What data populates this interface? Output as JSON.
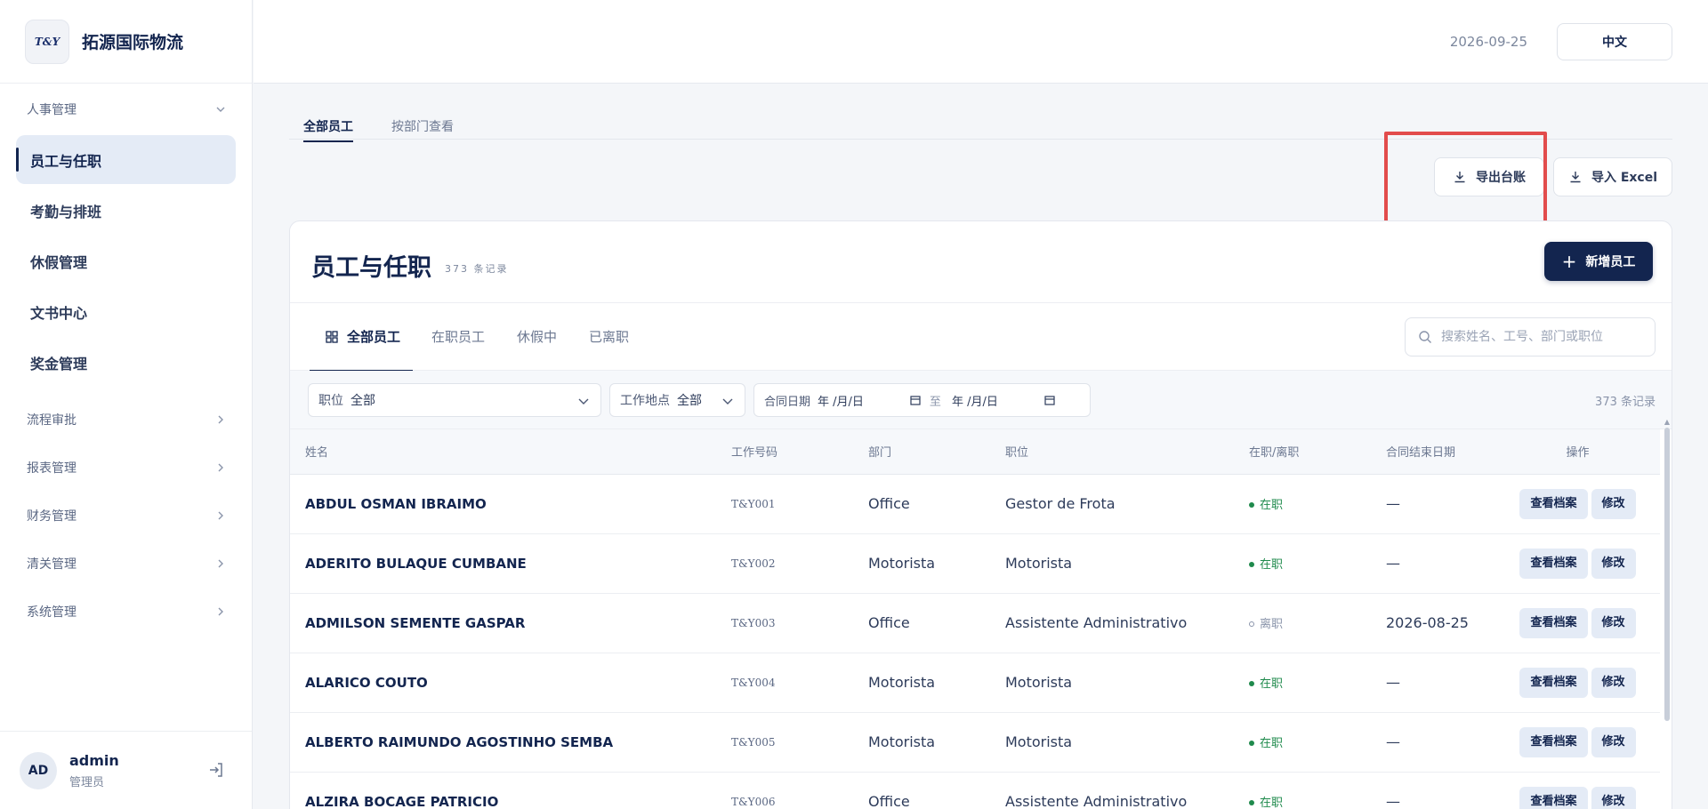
{
  "brand": {
    "logo_text": "T&Y",
    "name": "拓源国际物流"
  },
  "sidebar": {
    "groups": [
      {
        "label": "人事管理",
        "open": true
      },
      {
        "label": "流程审批"
      },
      {
        "label": "报表管理"
      },
      {
        "label": "财务管理"
      },
      {
        "label": "清关管理"
      },
      {
        "label": "系统管理"
      }
    ],
    "items": [
      {
        "label": "员工与任职",
        "active": true
      },
      {
        "label": "考勤与排班"
      },
      {
        "label": "休假管理"
      },
      {
        "label": "文书中心"
      },
      {
        "label": "奖金管理"
      }
    ]
  },
  "user": {
    "initials": "AD",
    "name": "admin",
    "role": "管理员"
  },
  "topbar": {
    "date": "2026-09-25",
    "language": "中文"
  },
  "page_tabs": [
    {
      "label": "全部员工",
      "active": true
    },
    {
      "label": "按部门查看"
    }
  ],
  "actions": {
    "export_label": "导出台账",
    "import_label": "导入 Excel"
  },
  "card": {
    "title": "员工与任职",
    "count": "373 条记录",
    "add_label": "新增员工",
    "status_tabs": [
      "全部员工",
      "在职员工",
      "休假中",
      "已离职"
    ],
    "search_placeholder": "搜索姓名、工号、部门或职位",
    "filters": {
      "position_label": "职位",
      "position_value": "全部",
      "location_label": "工作地点",
      "location_value": "全部",
      "date_label": "合同日期",
      "date_from": "年 /月/日",
      "date_sep": "至",
      "date_to": "年 /月/日"
    },
    "records_right": "373 条记录"
  },
  "table": {
    "columns": [
      "姓名",
      "工作号码",
      "部门",
      "职位",
      "在职/离职",
      "合同结束日期",
      "操作"
    ],
    "view_label": "查看档案",
    "edit_label": "修改",
    "rows": [
      {
        "name": "ABDUL OSMAN IBRAIMO",
        "code": "T&Y001",
        "dept": "Office",
        "position": "Gestor de Frota",
        "status": "在职",
        "active": true,
        "end": "—"
      },
      {
        "name": "ADERITO BULAQUE CUMBANE",
        "code": "T&Y002",
        "dept": "Motorista",
        "position": "Motorista",
        "status": "在职",
        "active": true,
        "end": "—"
      },
      {
        "name": "ADMILSON SEMENTE GASPAR",
        "code": "T&Y003",
        "dept": "Office",
        "position": "Assistente Administrativo",
        "status": "离职",
        "active": false,
        "end": "2026-08-25"
      },
      {
        "name": "ALARICO COUTO",
        "code": "T&Y004",
        "dept": "Motorista",
        "position": "Motorista",
        "status": "在职",
        "active": true,
        "end": "—"
      },
      {
        "name": "ALBERTO RAIMUNDO AGOSTINHO SEMBA",
        "code": "T&Y005",
        "dept": "Motorista",
        "position": "Motorista",
        "status": "在职",
        "active": true,
        "end": "—"
      },
      {
        "name": "ALZIRA BOCAGE PATRICIO",
        "code": "T&Y006",
        "dept": "Office",
        "position": "Assistente Administrativo",
        "status": "在职",
        "active": true,
        "end": "—"
      }
    ]
  }
}
